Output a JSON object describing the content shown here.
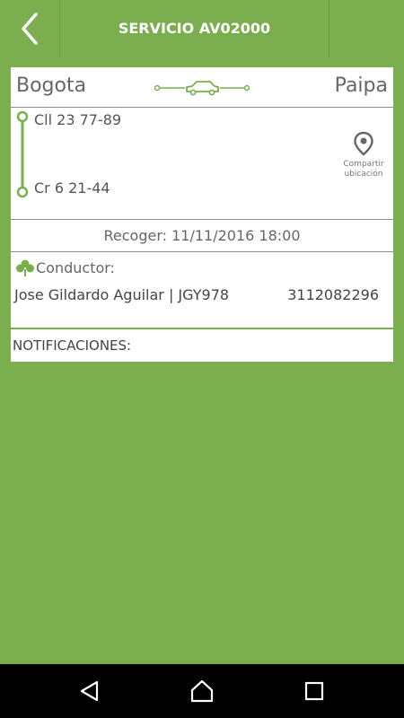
{
  "header": {
    "title": "SERVICIO AV02000",
    "back_icon": "chevron-left-icon"
  },
  "route": {
    "from_city": "Bogota",
    "to_city": "Paipa",
    "from_address": "Cll 23 77-89",
    "to_address": "Cr 6 21-44",
    "share_label_line1": "Compartir",
    "share_label_line2": "ubicación"
  },
  "pickup": {
    "text": "Recoger: 11/11/2016 18:00"
  },
  "driver": {
    "label": "Conductor:",
    "name_plate": "Jose Gildardo Aguilar | JGY978",
    "phone": "3112082296"
  },
  "notifications": {
    "label": "NOTIFICACIONES:"
  },
  "colors": {
    "background": "#7aae4f",
    "accent": "#7aae4f",
    "card": "#ffffff"
  }
}
